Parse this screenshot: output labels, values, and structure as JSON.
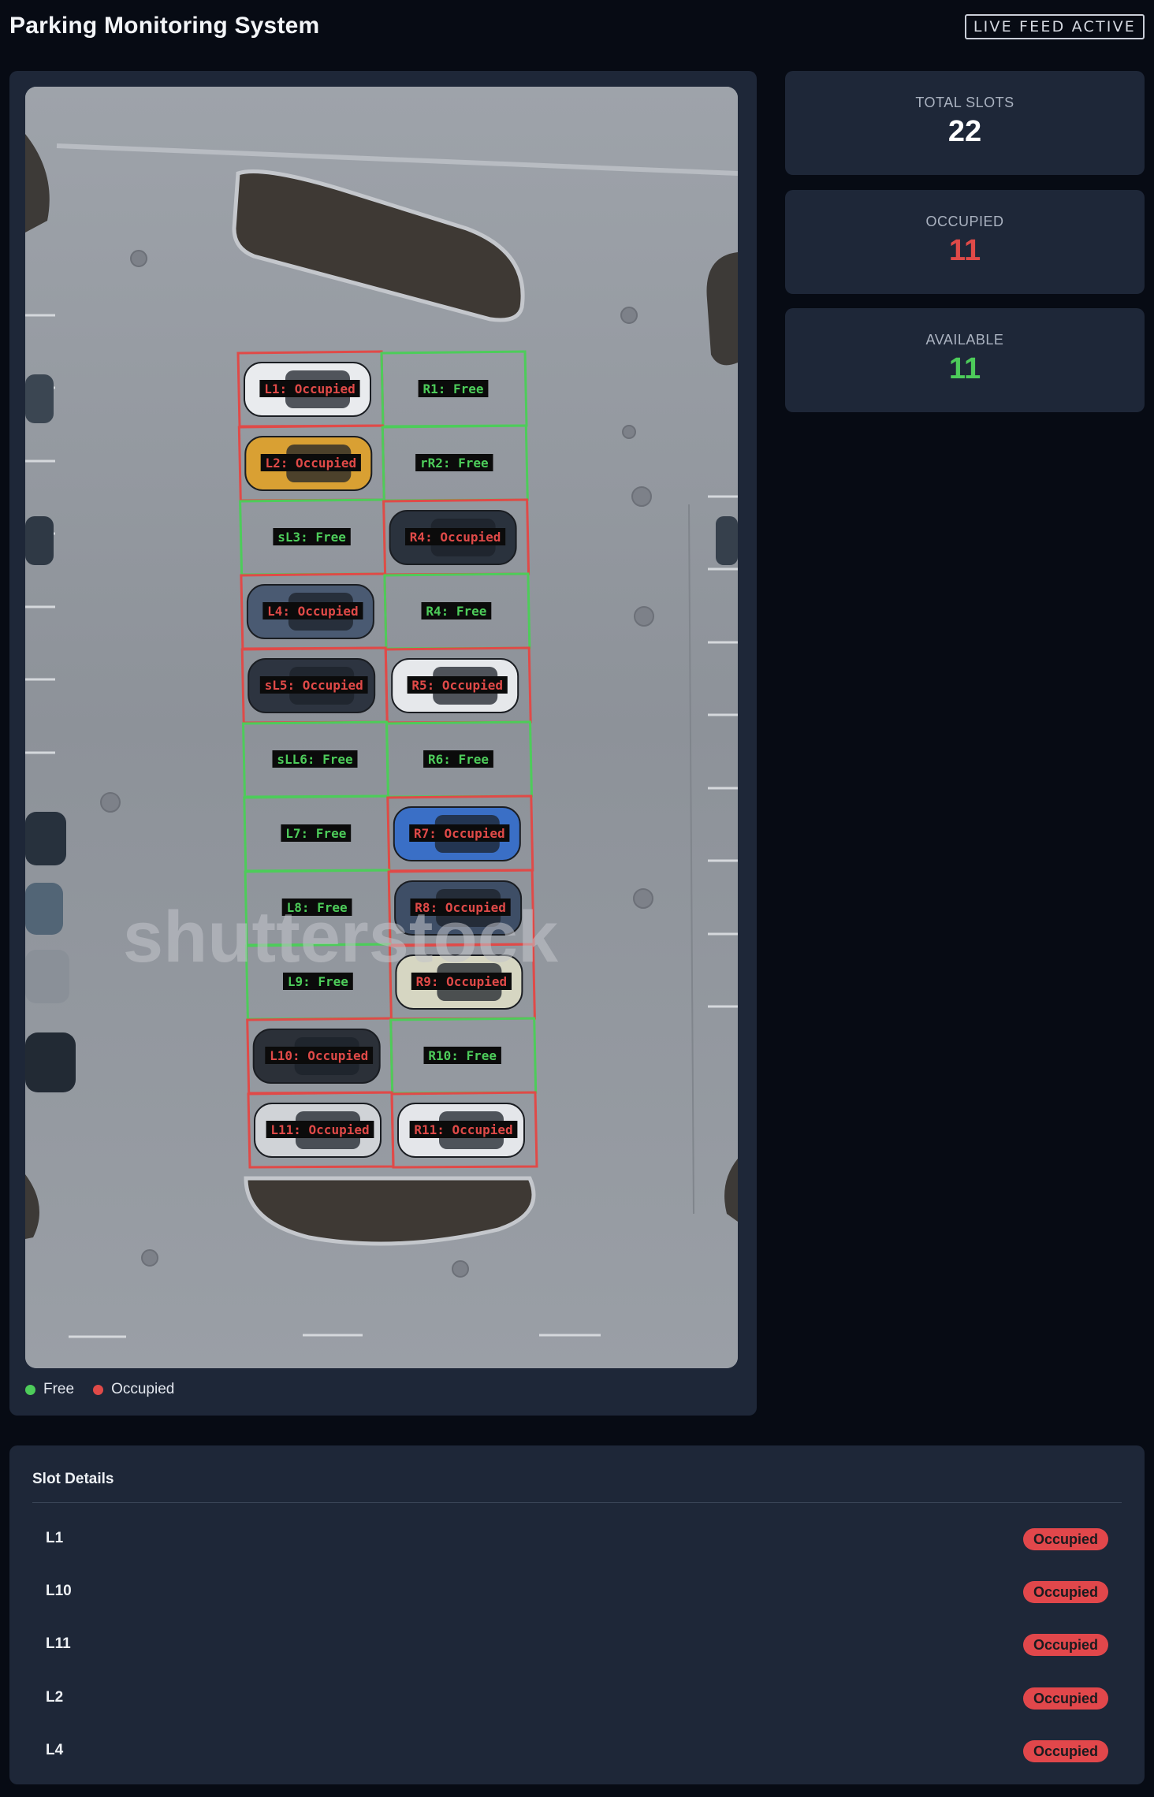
{
  "header": {
    "title": "Parking Monitoring System",
    "live_badge": "LIVE FEED ACTIVE"
  },
  "colors": {
    "free": "#4dcc5a",
    "occupied": "#e04a48",
    "panel": "#1e2738",
    "background": "#070b14"
  },
  "stats": {
    "total": {
      "label": "TOTAL SLOTS",
      "value": "22"
    },
    "occupied": {
      "label": "OCCUPIED",
      "value": "11"
    },
    "available": {
      "label": "AVAILABLE",
      "value": "11"
    }
  },
  "feed": {
    "watermark": "shutterstock",
    "overlay_labels": [
      {
        "text": "L1: Occupied",
        "status": "occupied"
      },
      {
        "text": "R1: Free",
        "status": "free"
      },
      {
        "text": "L2: Occupied",
        "status": "occupied"
      },
      {
        "text": "rR2: Free",
        "status": "free"
      },
      {
        "text": "sL3: Free",
        "status": "free"
      },
      {
        "text": "R4: Occupied",
        "status": "occupied"
      },
      {
        "text": "L4: Occupied",
        "status": "occupied"
      },
      {
        "text": "R4: Free",
        "status": "free"
      },
      {
        "text": "sL5: Occupied",
        "status": "occupied"
      },
      {
        "text": "R5: Occupied",
        "status": "occupied"
      },
      {
        "text": "sLL6: Free",
        "status": "free"
      },
      {
        "text": "R6: Free",
        "status": "free"
      },
      {
        "text": "L7: Free",
        "status": "free"
      },
      {
        "text": "R7: Occupied",
        "status": "occupied"
      },
      {
        "text": "L8: Free",
        "status": "free"
      },
      {
        "text": "R8: Occupied",
        "status": "occupied"
      },
      {
        "text": "L9: Free",
        "status": "free"
      },
      {
        "text": "R9: Occupied",
        "status": "occupied"
      },
      {
        "text": "L10: Occupied",
        "status": "occupied"
      },
      {
        "text": "R10: Free",
        "status": "free"
      },
      {
        "text": "L11: Occupied",
        "status": "occupied"
      },
      {
        "text": "R11: Occupied",
        "status": "occupied"
      }
    ]
  },
  "legend": {
    "free": "Free",
    "occupied": "Occupied"
  },
  "slot_details": {
    "title": "Slot Details",
    "rows": [
      {
        "name": "L1",
        "status": "Occupied"
      },
      {
        "name": "L10",
        "status": "Occupied"
      },
      {
        "name": "L11",
        "status": "Occupied"
      },
      {
        "name": "L2",
        "status": "Occupied"
      },
      {
        "name": "L4",
        "status": "Occupied"
      }
    ]
  }
}
